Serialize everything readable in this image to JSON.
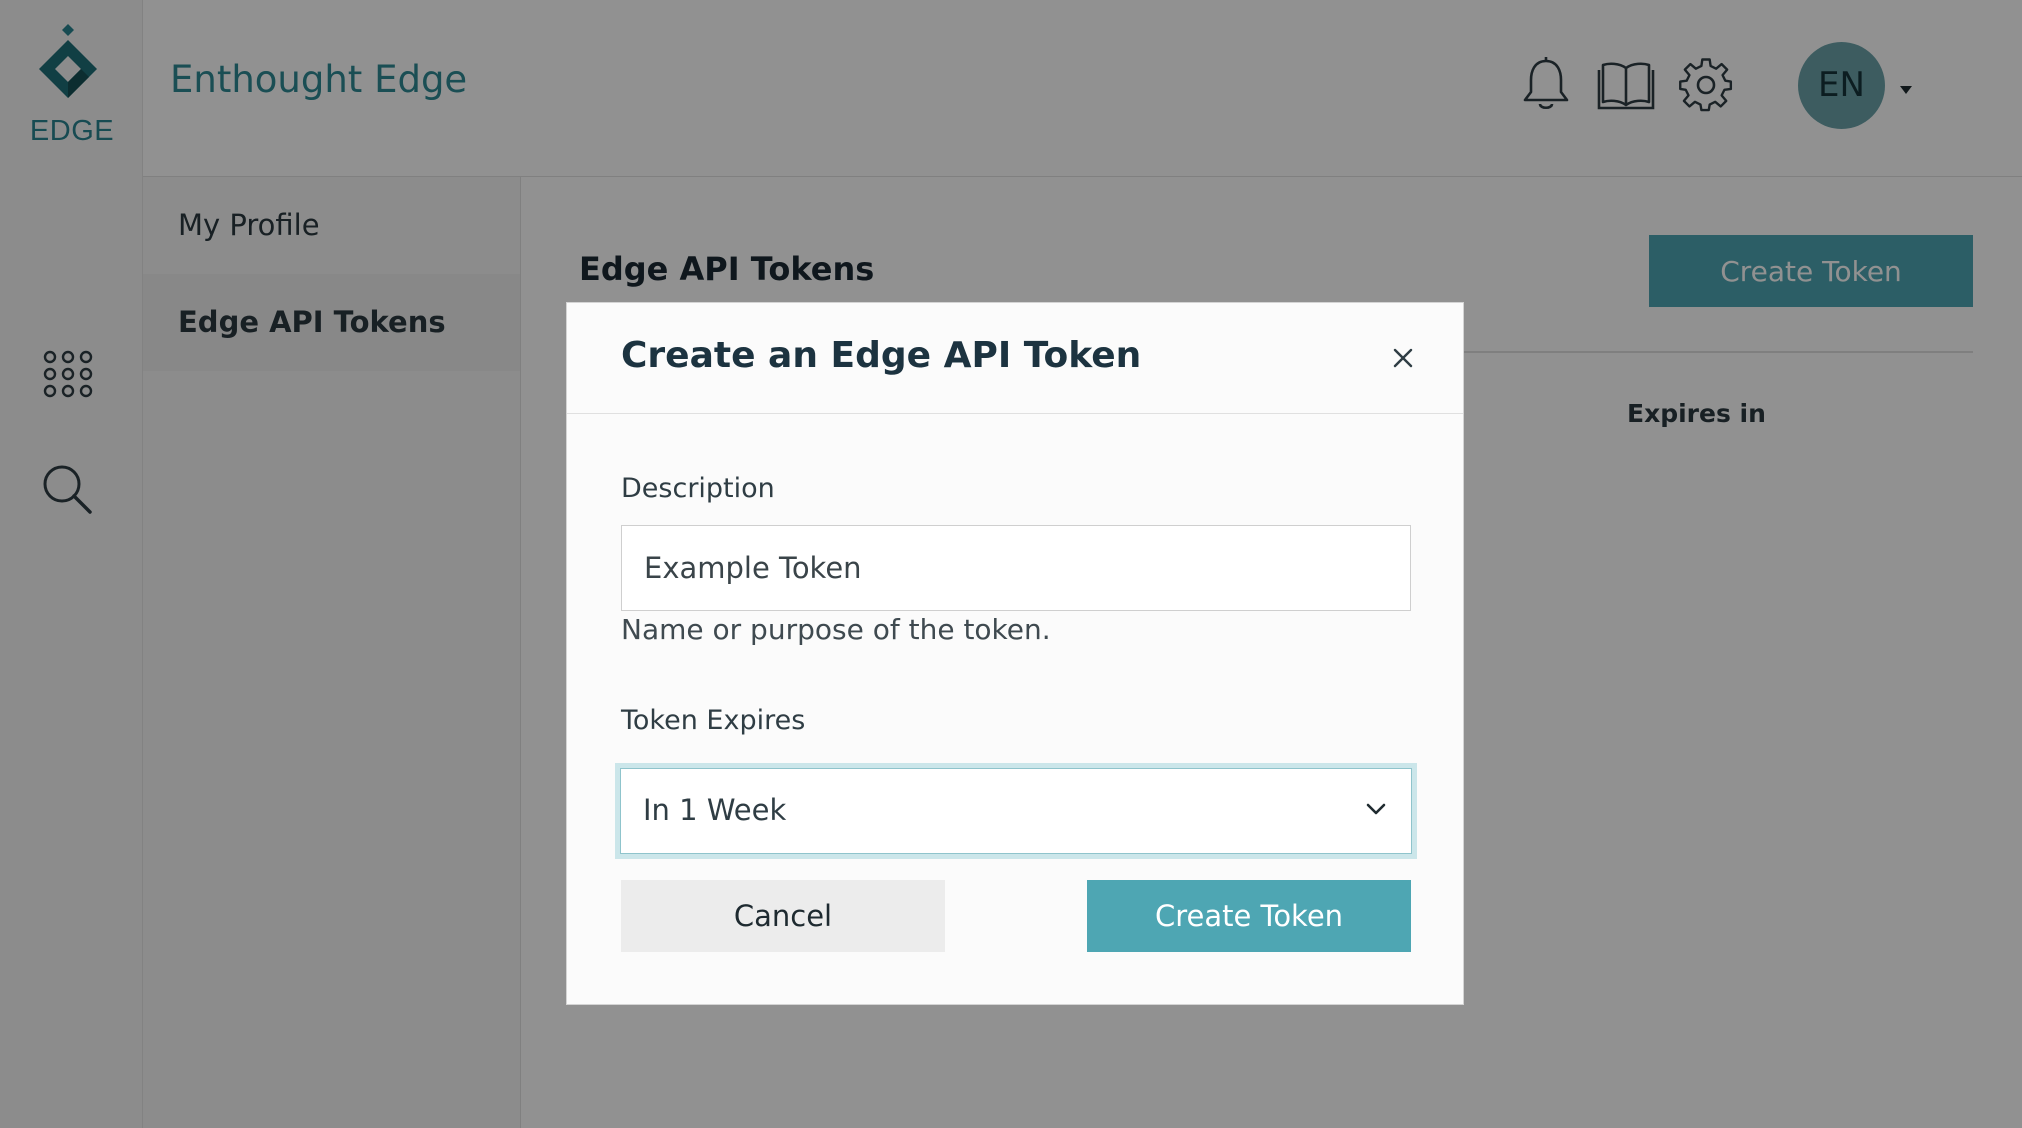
{
  "brand": {
    "logo_text": "EDGE",
    "app_title": "Enthought Edge",
    "accent": "#4ea6b3",
    "brand_teal": "#2a8590"
  },
  "rail": {
    "icons": [
      "apps-grid-icon",
      "search-icon"
    ]
  },
  "topbar": {
    "icons": [
      "bell-icon",
      "book-icon",
      "gear-icon"
    ],
    "avatar_initials": "EN"
  },
  "subnav": {
    "items": [
      {
        "label": "My Profile",
        "active": false
      },
      {
        "label": "Edge API Tokens",
        "active": true
      }
    ]
  },
  "main": {
    "heading": "Edge API Tokens",
    "create_button": "Create Token",
    "columns": {
      "expires": "Expires in"
    }
  },
  "modal": {
    "title": "Create an Edge API Token",
    "description_label": "Description",
    "description_value": "Example Token",
    "description_help": "Name or purpose of the token.",
    "expires_label": "Token Expires",
    "expires_selected": "In 1 Week",
    "cancel_label": "Cancel",
    "create_label": "Create Token"
  }
}
